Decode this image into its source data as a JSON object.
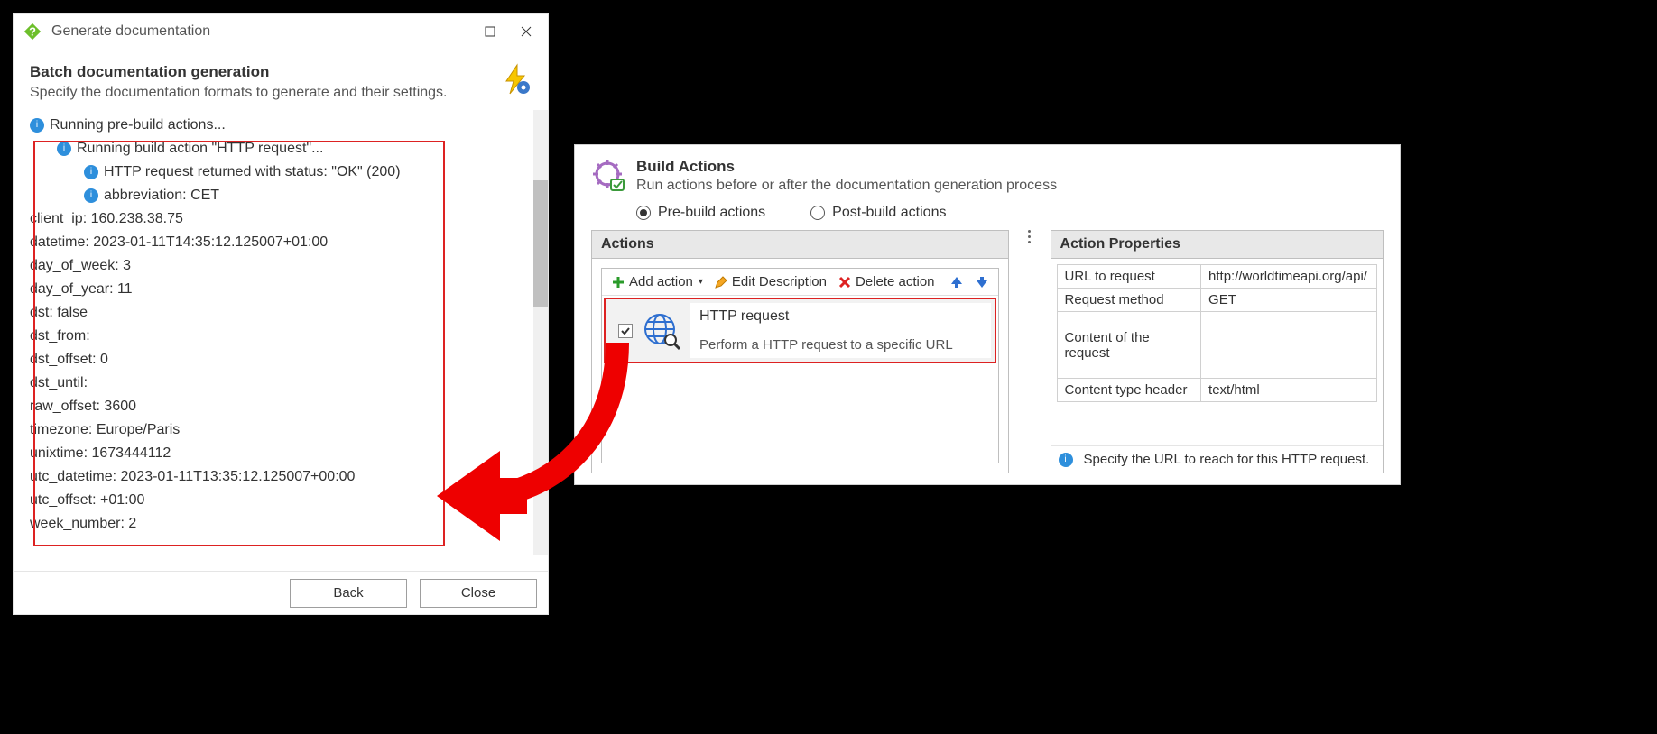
{
  "dialog1": {
    "title": "Generate documentation",
    "header_title": "Batch documentation generation",
    "header_sub": "Specify the documentation formats to generate and their settings.",
    "log": {
      "line0": "Running pre-build actions...",
      "line1": "Running build action \"HTTP request\"...",
      "line2": "HTTP request returned with status: \"OK\" (200)",
      "line3": "abbreviation: CET",
      "line4": "client_ip: 160.238.38.75",
      "line5": "datetime: 2023-01-11T14:35:12.125007+01:00",
      "line6": "day_of_week: 3",
      "line7": "day_of_year: 11",
      "line8": "dst: false",
      "line9": "dst_from:",
      "line10": "dst_offset: 0",
      "line11": "dst_until:",
      "line12": "raw_offset: 3600",
      "line13": "timezone: Europe/Paris",
      "line14": "unixtime: 1673444112",
      "line15": "utc_datetime: 2023-01-11T13:35:12.125007+00:00",
      "line16": "utc_offset: +01:00",
      "line17": "week_number: 2"
    },
    "btn_back": "Back",
    "btn_close": "Close"
  },
  "dialog2": {
    "header_title": "Build Actions",
    "header_sub": "Run actions before or after the documentation generation process",
    "radio_pre": "Pre-build actions",
    "radio_post": "Post-build actions",
    "actions": {
      "title": "Actions",
      "toolbar": {
        "add": "Add action",
        "edit": "Edit Description",
        "del": "Delete action"
      },
      "item": {
        "name": "HTTP request",
        "desc": "Perform a HTTP request to a specific URL"
      }
    },
    "props": {
      "title": "Action Properties",
      "rows": {
        "r0k": "URL to request",
        "r0v": "http://worldtimeapi.org/api/",
        "r1k": "Request method",
        "r1v": "GET",
        "r2k": "Content of the request",
        "r2v": "",
        "r3k": "Content type header",
        "r3v": "text/html"
      },
      "hint": "Specify the URL to reach for this HTTP request."
    }
  }
}
